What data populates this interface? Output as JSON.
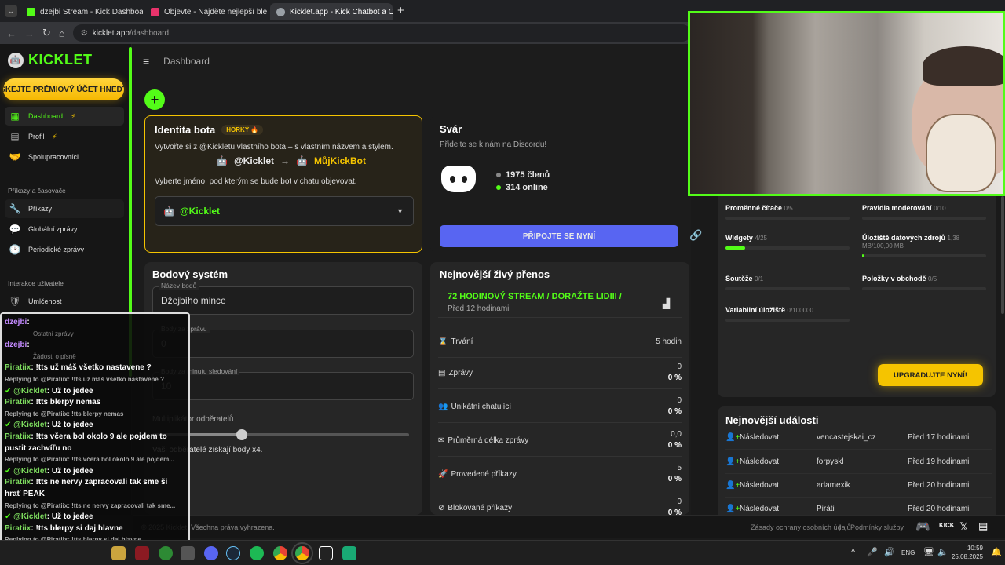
{
  "browser": {
    "tabs": [
      {
        "title": "dzejbi Stream - Kick Dashboard",
        "color": "#53fc18"
      },
      {
        "title": "Objevte - Najděte nejlepší blerp",
        "color": "#e8336b"
      },
      {
        "title": "Kicklet.app - Kick Chatbot a Ov",
        "color": "#9aa0a6"
      }
    ],
    "url_host": "kicklet.app",
    "url_path": "/dashboard"
  },
  "sidebar": {
    "logo": "KICKLET",
    "premium_banner": "SKEJTE PRÉMIOVÝ ÚČET HNEDT",
    "items": [
      {
        "label": "Dashboard",
        "badge": "⚡"
      },
      {
        "label": "Profil",
        "badge": "⚡"
      },
      {
        "label": "Spolupracovníci"
      }
    ],
    "section_commands": "Příkazy a časovače",
    "commands_items": [
      {
        "label": "Příkazy"
      },
      {
        "label": "Globální zprávy"
      },
      {
        "label": "Periodické zprávy"
      }
    ],
    "section_interaction": "Interakce uživatele",
    "interaction_items": [
      {
        "label": "Umlčenost"
      }
    ]
  },
  "topbar": {
    "breadcrumb": "Dashboard"
  },
  "identity": {
    "title": "Identita bota",
    "badge": "HORKÝ 🔥",
    "desc": "Vytvořte si z @Kickletu vlastního bota – s vlastním názvem a stylem.",
    "from": "@Kicklet",
    "arrow": "→",
    "to": "MůjKickBot",
    "hint": "Vyberte jméno, pod kterým se bude bot v chatu objevovat.",
    "select_value": "@Kicklet"
  },
  "discord": {
    "title": "Svár",
    "subtitle": "Přidejte se k nám na Discordu!",
    "members": "1975 členů",
    "online": "314 online",
    "join_button": "PŘIPOJTE SE NYNÍ"
  },
  "points": {
    "title": "Bodový systém",
    "name_label": "Název bodů",
    "name_value": "Džejbího mince",
    "per_msg_label": "Body za zprávu",
    "per_msg_value": "0",
    "per_min_label": "Body za minutu sledování",
    "per_min_value": "10",
    "multiplier_label": "Multiplikátor odběratelů",
    "multiplier_note": "Vaši odběratelé získají body x4.",
    "slider_fraction": 0.35
  },
  "stream": {
    "title": "Nejnovější živý přenos",
    "stream_title": "72 HODINOVÝ STREAM / DORAŽTE LIDIII /",
    "ago": "Před 12 hodinami",
    "stats": [
      {
        "label": "Trvání",
        "icon": "⌛",
        "v1": "5 hodin",
        "v2": ""
      },
      {
        "label": "Zprávy",
        "icon": "▤",
        "v1": "0",
        "v2": "0 %"
      },
      {
        "label": "Unikátní chatující",
        "icon": "👥",
        "v1": "0",
        "v2": "0 %"
      },
      {
        "label": "Průměrná délka zprávy",
        "icon": "✉",
        "v1": "0,0",
        "v2": "0 %"
      },
      {
        "label": "Provedené příkazy",
        "icon": "🚀",
        "v1": "5",
        "v2": "0 %"
      },
      {
        "label": "Blokované příkazy",
        "icon": "⊘",
        "v1": "0",
        "v2": "0 %"
      }
    ]
  },
  "quotas": [
    {
      "label": "Proměnné čítače",
      "value": "0/5",
      "fill": 0
    },
    {
      "label": "Pravidla moderování",
      "value": "0/10",
      "fill": 0
    },
    {
      "label": "Widgety",
      "value": "4/25",
      "fill": 0.16
    },
    {
      "label": "Úložiště datových zdrojů",
      "value": "1,38 MB/100,00 MB",
      "fill": 0.014
    },
    {
      "label": "Soutěže",
      "value": "0/1",
      "fill": 0
    },
    {
      "label": "Položky v obchodě",
      "value": "0/5",
      "fill": 0
    },
    {
      "label": "Variabilní úložiště",
      "value": "0/100000",
      "fill": 0
    }
  ],
  "upgrade_button": "UPGRADUJTE NYNÍ!",
  "events": {
    "title": "Nejnovější události",
    "rows": [
      {
        "type": "Následovat",
        "user": "vencastejskai_cz",
        "time": "Před 17 hodinami"
      },
      {
        "type": "Následovat",
        "user": "forpyskl",
        "time": "Před 19 hodinami"
      },
      {
        "type": "Následovat",
        "user": "adamexik",
        "time": "Před 20 hodinami"
      },
      {
        "type": "Následovat",
        "user": "Piráti",
        "time": "Před 20 hodinami"
      }
    ]
  },
  "footer": {
    "copyright": "© 2025 Kicklet. Všechna práva vyhrazena.",
    "privacy": "Zásady ochrany osobních údajů",
    "sep": "|",
    "terms": "Podmínky služby",
    "kick": "KICK"
  },
  "chat": [
    {
      "name": "dzejbi",
      "text": "",
      "kind": "user"
    },
    {
      "name": "",
      "text": "Ostatní zprávy",
      "kind": "bg"
    },
    {
      "name": "dzejbi",
      "text": "",
      "kind": "user"
    },
    {
      "name": "",
      "text": "Žádosti o písně",
      "kind": "bg"
    },
    {
      "name": "Piratiix",
      "text": "!tts už máš všetko nastavene ?",
      "kind": "user"
    },
    {
      "name": "",
      "text": "Replying to @Piratiix: !tts už máš všetko nastavene ?",
      "kind": "reply"
    },
    {
      "name": "@Kicklet",
      "text": "Už to jedee",
      "kind": "bot"
    },
    {
      "name": "Piratiix",
      "text": "!tts blerpy nemas",
      "kind": "user"
    },
    {
      "name": "",
      "text": "Replying to @Piratiix: !tts blerpy nemas",
      "kind": "reply"
    },
    {
      "name": "@Kicklet",
      "text": "Už to jedee",
      "kind": "bot"
    },
    {
      "name": "Piratiix",
      "text": "!tts včera bol okolo 9 ale pojdem to",
      "kind": "user"
    },
    {
      "name": "",
      "text": "pustit zachvíľu no",
      "kind": "cont"
    },
    {
      "name": "",
      "text": "Replying to @Piratiix: !tts včera bol okolo 9 ale pojdem...",
      "kind": "reply"
    },
    {
      "name": "@Kicklet",
      "text": "Už to jedee",
      "kind": "bot"
    },
    {
      "name": "Piratiix",
      "text": "!tts ne nervy zapracovali tak sme ši",
      "kind": "user"
    },
    {
      "name": "",
      "text": "hrať PEAK",
      "kind": "cont"
    },
    {
      "name": "",
      "text": "Replying to @Piratiix: !tts ne nervy zapracovali tak sme...",
      "kind": "reply"
    },
    {
      "name": "@Kicklet",
      "text": "Už to jedee",
      "kind": "bot"
    },
    {
      "name": "Piratiix",
      "text": "!tts blerpy si daj hlavne",
      "kind": "user"
    },
    {
      "name": "",
      "text": "Replying to @Piratiix: !tts blerpy si daj hlavne",
      "kind": "reply"
    },
    {
      "name": "@Kicklet",
      "text": "Už to jedee",
      "kind": "bot"
    }
  ],
  "taskbar": {
    "lang": "ENG",
    "time": "10:59",
    "date": "25.08.2025"
  }
}
